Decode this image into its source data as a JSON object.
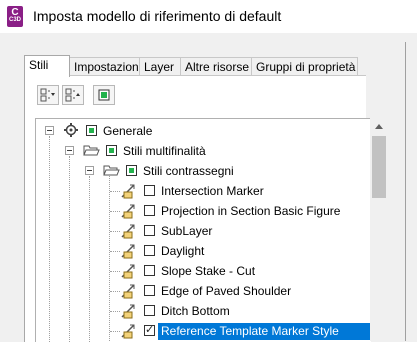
{
  "window": {
    "title": "Imposta modello di riferimento di default",
    "app_icon_letter": "C",
    "app_icon_version": "C3D"
  },
  "tabs": [
    {
      "label": "Stili",
      "active": true
    },
    {
      "label": "Impostazioni",
      "active": false
    },
    {
      "label": "Layer",
      "active": false
    },
    {
      "label": "Altre risorse",
      "active": false
    },
    {
      "label": "Gruppi di proprietà",
      "active": false
    }
  ],
  "toolbar": {
    "buttons": [
      "expand-down-icon",
      "collapse-up-icon",
      "select-all-icon"
    ]
  },
  "tree": {
    "root": {
      "label": "Generale",
      "state": "partial"
    },
    "level1": {
      "label": "Stili multifinalità",
      "state": "partial"
    },
    "level2": {
      "label": "Stili contrassegni",
      "state": "partial"
    },
    "items": [
      {
        "label": "Intersection Marker",
        "checked": false,
        "selected": false
      },
      {
        "label": "Projection in Section Basic Figure",
        "checked": false,
        "selected": false
      },
      {
        "label": "SubLayer",
        "checked": false,
        "selected": false
      },
      {
        "label": "Daylight",
        "checked": false,
        "selected": false
      },
      {
        "label": "Slope Stake - Cut",
        "checked": false,
        "selected": false
      },
      {
        "label": "Edge of Paved Shoulder",
        "checked": false,
        "selected": false
      },
      {
        "label": "Ditch Bottom",
        "checked": false,
        "selected": false
      },
      {
        "label": "Reference Template Marker Style",
        "checked": true,
        "selected": true
      }
    ]
  },
  "colors": {
    "selection": "#0078d7",
    "partial_check": "#22b14c",
    "app_icon": "#8a1f86"
  }
}
